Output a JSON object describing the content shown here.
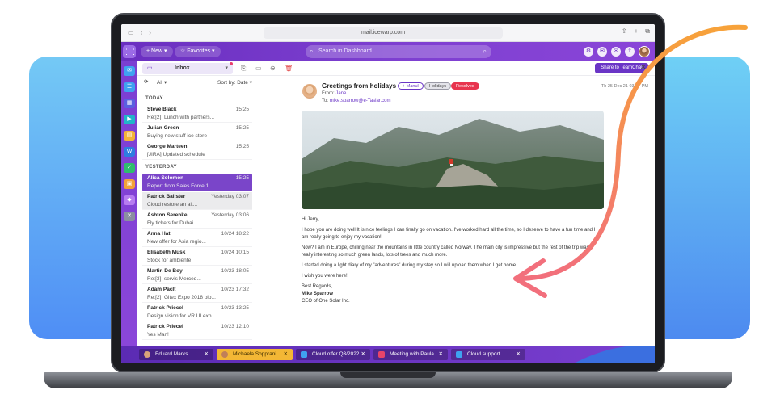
{
  "browser": {
    "url": "mail.icewarp.com"
  },
  "topbar": {
    "new_label": "New",
    "favorites_label": "Favorites",
    "search_placeholder": "Search in Dashboard"
  },
  "toolbar": {
    "folder_label": "Inbox",
    "share_label": "Share to TeamChat"
  },
  "list": {
    "filter_label": "All",
    "sort_label": "Sort by: Date",
    "sections": [
      "TODAY",
      "YESTERDAY"
    ],
    "today": [
      {
        "name": "Steve Black",
        "snippet": "Re:[2]: Lunch with partners...",
        "time": "15:25"
      },
      {
        "name": "Julian Green",
        "snippet": "Buying new stuff ice store",
        "time": "15:25"
      },
      {
        "name": "George Marteen",
        "snippet": "[JIRA] Updated schedule",
        "time": "15:25"
      }
    ],
    "yesterday": [
      {
        "name": "Alica Solomon",
        "snippet": "Report from Sales Force 1",
        "time": "15:25"
      },
      {
        "name": "Patrick Balister",
        "snippet": "Cloud restore an alt...",
        "time": "Yesterday 03:07"
      },
      {
        "name": "Ashton Serenke",
        "snippet": "Fly tickets for Dubai...",
        "time": "Yesterday 03:06"
      },
      {
        "name": "Anna Hat",
        "snippet": "New offer for Asia regio...",
        "time": "10/24 18:22"
      },
      {
        "name": "Elisabeth Musk",
        "snippet": "Stock for ambiente",
        "time": "10/24 10:15"
      },
      {
        "name": "Martin De Boy",
        "snippet": "Re:[3]: servis Merced...",
        "time": "10/23 18:05"
      },
      {
        "name": "Adam Paclt",
        "snippet": "Re:[2]: Gitex Expo 2018 plo...",
        "time": "10/23 17:32"
      },
      {
        "name": "Patrick Priecel",
        "snippet": "Design vision for VR UI exp...",
        "time": "10/23 13:25"
      },
      {
        "name": "Patrick Priecel",
        "snippet": "Yes Man!",
        "time": "10/23 12:10"
      }
    ]
  },
  "message": {
    "subject": "Greetings from holidays",
    "tags": [
      {
        "label": "+ Manul",
        "bg": "#ffffff",
        "fg": "#6a35c6",
        "border": "#6a35c6"
      },
      {
        "label": "Holidays",
        "bg": "#e4e4ea",
        "fg": "#444444",
        "border": "#9a9aa6"
      },
      {
        "label": "Resolved",
        "bg": "#e8344e",
        "fg": "#ffffff",
        "border": "#e8344e"
      }
    ],
    "from_label": "From:",
    "from_name": "Jane",
    "to_label": "To:",
    "to_address": "mike.sparrow@e-Taslar.com",
    "date": "Th 25 Dec 21 03:07 PM",
    "body": [
      "Hi Jerry,",
      "I hope you are doing well.It is nice feelings I can finally go on vacation. I've worked hard all the time, so I deserve to have a fun time and I am really going to enjoy my vacation!",
      "Now? I am in Europe, chilling near the mountains in little country called Norway. The main city is impressive but the rest of the trip was a really interesting so much green lands, lots of trees and much more.",
      "I started doing a light diary of my \"adventures\" during my stay so I will upload them when I get home.",
      "I wish you were here!"
    ],
    "signoff": "Best Regards,",
    "signature_name": "Mike Sparrow",
    "signature_title": "CEO of One Solar Inc."
  },
  "taskbar": [
    {
      "label": "Eduard Marks",
      "state": "dark"
    },
    {
      "label": "Michaela Sopprani",
      "state": "active"
    },
    {
      "label": "Cloud offer Q3/2022",
      "state": "dark"
    },
    {
      "label": "Meeting with Paula",
      "state": "dark"
    },
    {
      "label": "Cloud support",
      "state": "dark"
    }
  ],
  "colors": {
    "accent": "#6a35c6",
    "selected_row": "#7a45c9",
    "arrow": "#f47a7a",
    "active_task": "#f3b735"
  }
}
